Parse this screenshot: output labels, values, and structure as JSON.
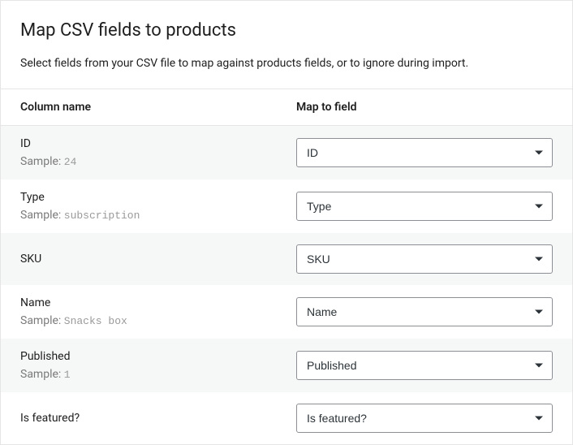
{
  "header": {
    "title": "Map CSV fields to products",
    "subtitle": "Select fields from your CSV file to map against products fields, or to ignore during import."
  },
  "table": {
    "column_name_header": "Column name",
    "map_to_field_header": "Map to field",
    "sample_prefix": "Sample:"
  },
  "rows": [
    {
      "name": "ID",
      "sample": "24",
      "mapped": "ID"
    },
    {
      "name": "Type",
      "sample": "subscription",
      "mapped": "Type"
    },
    {
      "name": "SKU",
      "sample": null,
      "mapped": "SKU"
    },
    {
      "name": "Name",
      "sample": "Snacks box",
      "mapped": "Name"
    },
    {
      "name": "Published",
      "sample": "1",
      "mapped": "Published"
    },
    {
      "name": "Is featured?",
      "sample": null,
      "mapped": "Is featured?"
    }
  ]
}
